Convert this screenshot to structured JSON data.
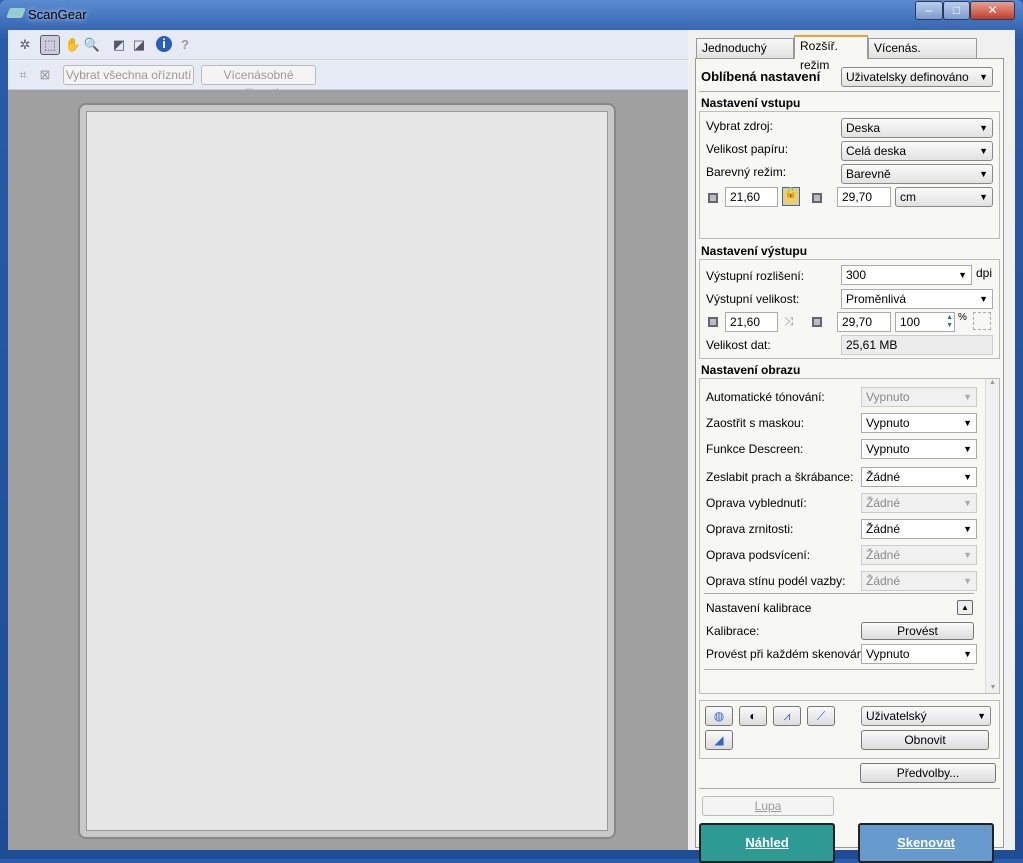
{
  "window": {
    "title": "ScanGear",
    "minimize": "–",
    "maximize": "□",
    "close": "✕"
  },
  "toolbar": {
    "select_all_crops": "Vybrat všechna oříznutí",
    "multi_crop": "Vícenásobné oříznutí"
  },
  "tabs": [
    {
      "label": "Jednoduchý režim"
    },
    {
      "label": "Rozšíř. režim"
    },
    {
      "label": "Vícenás. skenování"
    }
  ],
  "favorites": {
    "label": "Oblíbená nastavení",
    "value": "Uživatelsky definováno"
  },
  "input": {
    "heading": "Nastavení vstupu",
    "source_label": "Vybrat zdroj:",
    "source": "Deska",
    "paper_label": "Velikost papíru:",
    "paper": "Celá deska",
    "color_label": "Barevný režim:",
    "color": "Barevně",
    "width": "21,60",
    "height": "29,70",
    "unit": "cm"
  },
  "output": {
    "heading": "Nastavení výstupu",
    "res_label": "Výstupní rozlišení:",
    "res": "300",
    "res_unit": "dpi",
    "size_label": "Výstupní velikost:",
    "size": "Proměnlivá",
    "width": "21,60",
    "height": "29,70",
    "scale": "100",
    "scale_unit": "%",
    "data_label": "Velikost dat:",
    "data": "25,61 MB"
  },
  "image": {
    "heading": "Nastavení obrazu",
    "rows": [
      {
        "label": "Automatické tónování:",
        "value": "Vypnuto",
        "disabled": true
      },
      {
        "label": "Zaostřit s maskou:",
        "value": "Vypnuto",
        "disabled": false
      },
      {
        "label": "Funkce Descreen:",
        "value": "Vypnuto",
        "disabled": false
      },
      {
        "label": "Zeslabit prach a škrábance:",
        "value": "Žádné",
        "disabled": false
      },
      {
        "label": "Oprava vyblednutí:",
        "value": "Žádné",
        "disabled": true
      },
      {
        "label": "Oprava zrnitosti:",
        "value": "Žádné",
        "disabled": false
      },
      {
        "label": "Oprava podsvícení:",
        "value": "Žádné",
        "disabled": true
      },
      {
        "label": "Oprava stínu podél vazby:",
        "value": "Žádné",
        "disabled": true
      }
    ],
    "calib_heading": "Nastavení kalibrace",
    "calib_label": "Kalibrace:",
    "calib_button": "Provést",
    "each_label": "Provést při každém skenování:",
    "each_value": "Vypnuto"
  },
  "tools": {
    "preset": "Uživatelský",
    "reset": "Obnovit",
    "preferences": "Předvolby..."
  },
  "actions": {
    "zoom": "Lupa",
    "preview": "Náhled",
    "scan": "Skenovat"
  },
  "colors": {
    "preview": "#2e9a94",
    "scan": "#6699cc"
  }
}
